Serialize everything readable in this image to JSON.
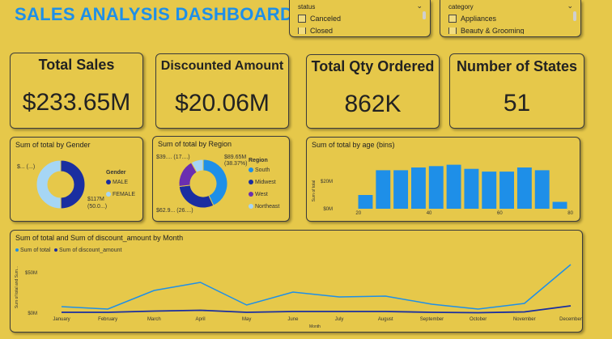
{
  "header": {
    "title": "SALES ANALYSIS DASHBOARD"
  },
  "slicers": {
    "status": {
      "label": "status",
      "options": [
        "Canceled",
        "Closed"
      ]
    },
    "category": {
      "label": "category",
      "options": [
        "Appliances",
        "Beauty & Grooming"
      ]
    }
  },
  "kpis": [
    {
      "label": "Total Sales",
      "value": "$233.65M"
    },
    {
      "label": "Discounted Amount",
      "value": "$20.06M"
    },
    {
      "label": "Total Qty Ordered",
      "value": "862K"
    },
    {
      "label": "Number of States",
      "value": "51"
    }
  ],
  "colors": {
    "background": "#e6c84a",
    "accent": "#1e8fe8",
    "dark_blue": "#1a2ea0",
    "light_blue": "#a6d6f5",
    "title_blue": "#1e8fe8"
  },
  "chart_data": [
    {
      "type": "pie",
      "title": "Sum of total by Gender",
      "legend_title": "Gender",
      "legend_position": "right",
      "categories": [
        "MALE",
        "FEMALE"
      ],
      "values": [
        116.65,
        117
      ],
      "data_labels": [
        "$... (...)",
        "$117M (50.0...)"
      ]
    },
    {
      "type": "pie",
      "title": "Sum of total by Region",
      "legend_title": "Region",
      "legend_position": "right",
      "categories": [
        "South",
        "Midwest",
        "West",
        "Northeast"
      ],
      "values": [
        89.65,
        62.9,
        39,
        17
      ],
      "data_labels": [
        "$89.65M (38.37%)",
        "$62.9... (26....)",
        "$39.... (17....)",
        ""
      ]
    },
    {
      "type": "bar",
      "title": "Sum of total by age (bins)",
      "ylabel": "Sum of total",
      "x": [
        22,
        27,
        32,
        37,
        42,
        47,
        52,
        57,
        62,
        67,
        72,
        77
      ],
      "values": [
        10,
        28,
        28,
        30,
        31,
        32,
        29,
        27,
        27,
        30,
        28,
        5
      ],
      "xticks": [
        20,
        40,
        60,
        80
      ],
      "yticks": [
        "$0M",
        "$20M"
      ],
      "ylim": [
        0,
        40
      ],
      "xlim": [
        18,
        81
      ]
    },
    {
      "type": "line",
      "title": "Sum of total and Sum of discount_amount by Month",
      "xlabel": "Month",
      "ylabel": "Sum of total and Sum...",
      "legend_position": "top-left",
      "categories": [
        "January",
        "February",
        "March",
        "April",
        "May",
        "June",
        "July",
        "August",
        "September",
        "October",
        "November",
        "December"
      ],
      "ylim": [
        0,
        70
      ],
      "yticks": [
        "$0M",
        "$50M"
      ],
      "series": [
        {
          "name": "Sum of total",
          "values": [
            8,
            5,
            28,
            38,
            10,
            26,
            20,
            21,
            11,
            5,
            12,
            60
          ]
        },
        {
          "name": "Sum of discount_amount",
          "values": [
            1,
            1,
            2.5,
            3.5,
            1,
            2,
            2,
            2,
            1,
            0.5,
            1.5,
            9
          ]
        }
      ]
    }
  ]
}
